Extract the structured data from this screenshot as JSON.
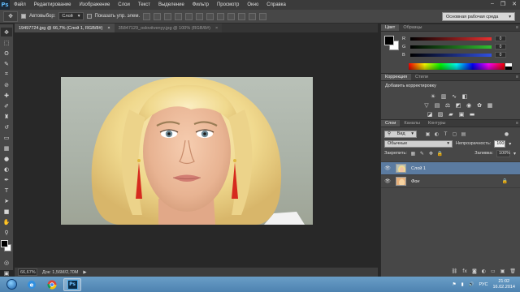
{
  "app": {
    "logo": "Ps"
  },
  "menubar": {
    "items": [
      "Файл",
      "Редактирование",
      "Изображение",
      "Слои",
      "Текст",
      "Выделение",
      "Фильтр",
      "Просмотр",
      "Окно",
      "Справка"
    ]
  },
  "options": {
    "autoselect_label": "Автовыбор:",
    "autoselect_value": "Слой",
    "show_controls_label": "Показать упр. элем.",
    "workspace": "Основная рабочая среда"
  },
  "documents": {
    "tabs": [
      {
        "title": "19497724.jpg @ 66,7% (Слой 1, RGB/8#)",
        "close": "×"
      },
      {
        "title": "35847129_oslovitvenyy.jpg @ 100% (RGB/8#)",
        "close": "×"
      }
    ]
  },
  "status": {
    "zoom": "66,67%",
    "doc_size": "Док: 1,56M/2,70M",
    "arrow": "▶"
  },
  "color_panel": {
    "tabs": [
      "Цвет",
      "Образцы"
    ],
    "channels": [
      {
        "letter": "R",
        "value": "0"
      },
      {
        "letter": "G",
        "value": "0"
      },
      {
        "letter": "B",
        "value": "0"
      }
    ]
  },
  "adjustments_panel": {
    "tabs": [
      "Коррекция",
      "Стили"
    ],
    "title": "Добавить корректировку",
    "row1_icons": [
      "brightness-contrast-icon",
      "levels-icon",
      "curves-icon",
      "exposure-icon"
    ],
    "row2_icons": [
      "vibrance-icon",
      "hue-saturation-icon",
      "color-balance-icon",
      "black-white-icon",
      "photo-filter-icon",
      "channel-mixer-icon",
      "color-lookup-icon"
    ],
    "row3_icons": [
      "invert-icon",
      "posterize-icon",
      "threshold-icon",
      "selective-color-icon",
      "gradient-map-icon"
    ]
  },
  "layers_panel": {
    "tabs": [
      "Слои",
      "Каналы",
      "Контуры"
    ],
    "filter_kind": "Вид",
    "blend_mode": "Обычные",
    "opacity_label": "Непрозрачность:",
    "opacity_value": "100",
    "lock_label": "Закрепить:",
    "fill_label": "Заливка:",
    "fill_value": "100%",
    "layers": [
      {
        "name": "Слой 1",
        "visible": true,
        "selected": true
      },
      {
        "name": "Фон",
        "visible": true,
        "selected": false,
        "locked": true
      }
    ]
  },
  "taskbar": {
    "apps": [
      "Internet Explorer",
      "Chrome",
      "Photoshop"
    ],
    "active_app": "Ps",
    "language": "РУС",
    "time": "21:02",
    "date": "16.02.2014"
  },
  "colors": {
    "accent_selection": "#5b7ba0",
    "slider_r": "#e83030",
    "slider_g": "#30c030",
    "slider_b": "#3050e0"
  }
}
